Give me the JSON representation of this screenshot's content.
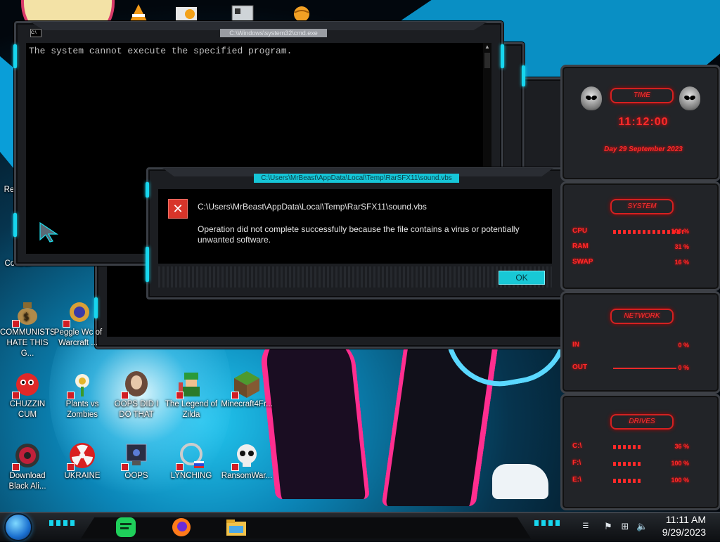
{
  "cmd_window": {
    "title": "C:\\Windows\\system32\\cmd.exe",
    "icon_text": "C:\\",
    "output_line": "The system cannot execute the specified program."
  },
  "alert_dialog": {
    "title": "C:\\Users\\MrBeast\\AppData\\Local\\Temp\\RarSFX11\\sound.vbs",
    "path": "C:\\Users\\MrBeast\\AppData\\Local\\Temp\\RarSFX11\\sound.vbs",
    "message": "Operation did not complete successfully because the file contains a virus or potentially unwanted software.",
    "ok_label": "OK",
    "accent": "#18c8d6",
    "error_color": "#d8352a"
  },
  "desktop": {
    "partial_labels": [
      "Re",
      "Control"
    ],
    "icons": [
      {
        "label": "COMMUNISTS HATE THIS G...",
        "icon": "money-bag-icon"
      },
      {
        "label": "Peggle Wc of Warcraft ...",
        "icon": "peggle-icon"
      },
      {
        "label": "CHUZZIN CUM",
        "icon": "chuzzle-icon"
      },
      {
        "label": "Plants vs Zombies",
        "icon": "flower-icon"
      },
      {
        "label": "OOPS DID I DO THAT",
        "icon": "portrait-icon"
      },
      {
        "label": "The Legend of Zilda",
        "icon": "zelda-icon"
      },
      {
        "label": "Minecraft4Fr...",
        "icon": "grass-block-icon"
      },
      {
        "label": "Download Black Ali...",
        "icon": "alien-orb-icon"
      },
      {
        "label": "UKRAINE",
        "icon": "radiation-icon"
      },
      {
        "label": "OOPS",
        "icon": "monitor-icon"
      },
      {
        "label": "LYNCHING",
        "icon": "hangman-icon"
      },
      {
        "label": "RansomWar...",
        "icon": "skull-icon"
      }
    ]
  },
  "gadget": {
    "time_label": "TIME",
    "time": "11:12:00",
    "date": "Day 29 September 2023",
    "system_label": "SYSTEM",
    "system_rows": [
      {
        "label": "CPU",
        "value": "100 %",
        "fraction": 1.0
      },
      {
        "label": "RAM",
        "value": "31 %",
        "fraction": 0.31
      },
      {
        "label": "SWAP",
        "value": "16 %",
        "fraction": 0.16
      }
    ],
    "network_label": "NETWORK",
    "network_rows": [
      {
        "label": "IN",
        "value": "0 %"
      },
      {
        "label": "OUT",
        "value": "0 %"
      }
    ],
    "drives_label": "DRIVES",
    "drive_rows": [
      {
        "label": "C:\\",
        "value": "36 %",
        "fraction": 0.36
      },
      {
        "label": "F:\\",
        "value": "100 %",
        "fraction": 1.0
      },
      {
        "label": "E:\\",
        "value": "100 %",
        "fraction": 1.0
      }
    ],
    "accent": "#ff2a2a"
  },
  "taskbar": {
    "apps": [
      "notes-app-icon",
      "firefox-icon",
      "file-explorer-icon"
    ],
    "tray": [
      "flag-icon",
      "network-icon",
      "volume-icon"
    ],
    "time": "11:11 AM",
    "date": "9/29/2023"
  }
}
